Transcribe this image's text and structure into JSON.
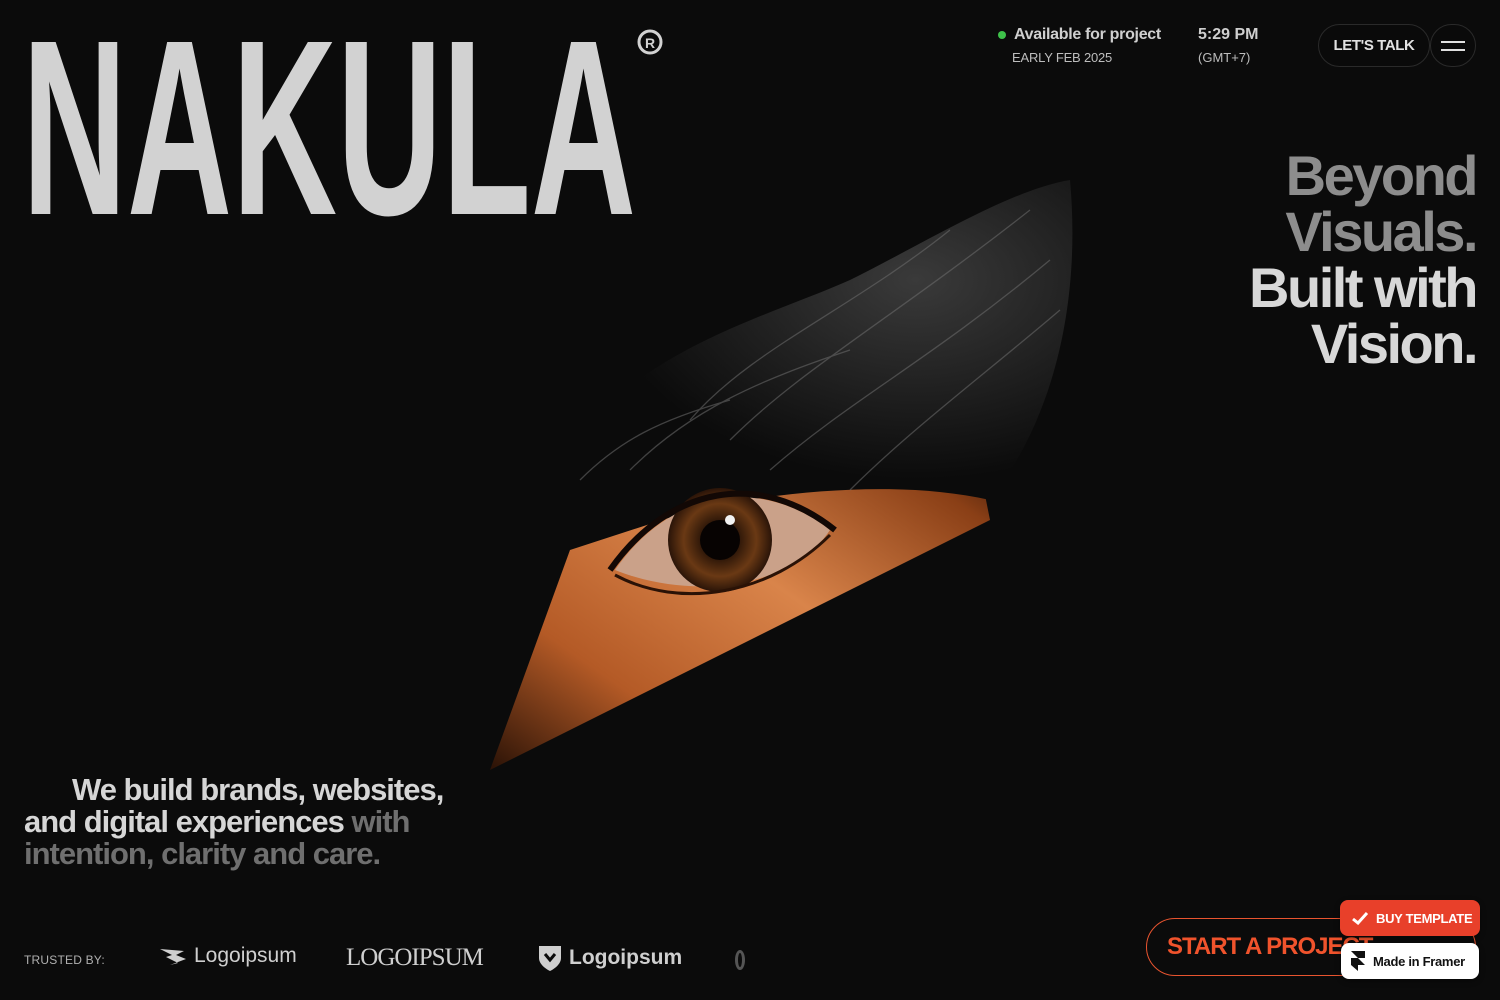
{
  "brand": {
    "wordmark": "NAKULA",
    "registered": "®"
  },
  "header": {
    "availability": "Available for project",
    "availability_date": "EARLY FEB 2025",
    "time": "5:29 PM",
    "timezone": "(GMT+7)",
    "talk_label": "LET'S TALK",
    "status_color": "#3ec14a"
  },
  "tagline": {
    "line1": "Beyond",
    "line2": "Visuals.",
    "line3": "Built with",
    "line4": "Vision."
  },
  "intro": {
    "lead_1": "We build brands, websites,",
    "lead_2": "and digital experiences",
    "rest": " with intention, clarity and care."
  },
  "trusted": {
    "label": "TRUSTED BY:",
    "logos": [
      "Logoipsum",
      "LOGOIPSUM",
      "Logoipsum"
    ]
  },
  "cta": {
    "label": "START A PROJECT",
    "accent": "#f0532c"
  },
  "badges": {
    "buy": "BUY TEMPLATE",
    "framer": "Made in Framer"
  }
}
